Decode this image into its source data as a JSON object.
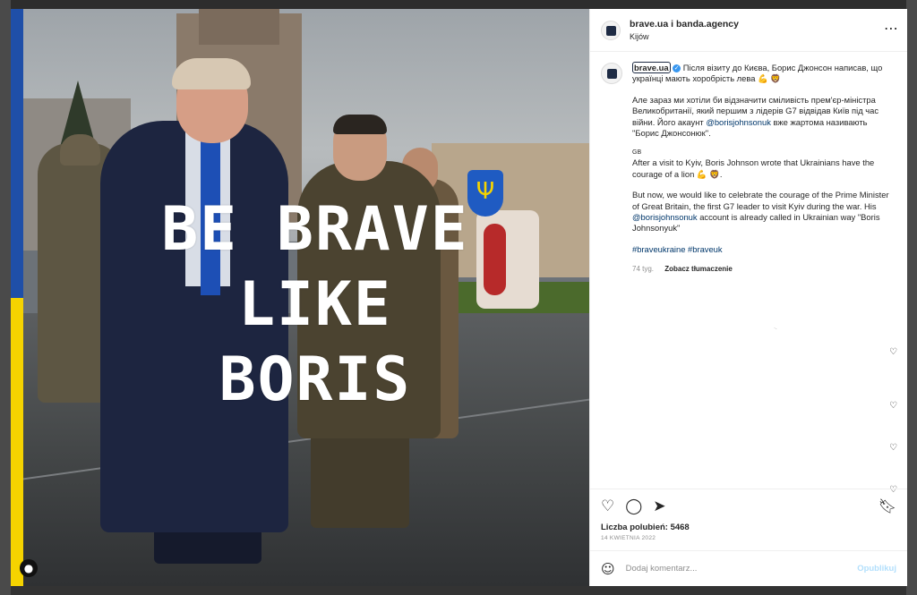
{
  "post": {
    "header": {
      "title": "brave.ua i banda.agency",
      "location": "Kijów",
      "more_icon": "more-horizontal-icon"
    },
    "image": {
      "slogan": [
        "BE BRAVE",
        "LIKE",
        "BORIS"
      ],
      "tag_icon": "user-tag-icon"
    },
    "caption": {
      "username": "brave.ua",
      "verified_icon": "verified-badge-icon",
      "ua_text": "Після візиту до Києва, Борис Джонсон написав, що українці мають хоробрість лева 💪 🦁",
      "ua_para2_a": "Але зараз ми хотіли би відзначити сміливість прем'єр-міністра Великобританії, який першим з лідерів G7 відвідав Київ під час війни. Його акаунт ",
      "ua_para2_link": "@borisjohnsonuk",
      "ua_para2_b": " вже жартома називають \"Борис Джонсонюк\".",
      "gb_label": "GB",
      "en_para1": "After a visit to Kyiv, Boris Johnson wrote that Ukrainians have the courage of a lion 💪 🦁.",
      "en_para2_a": "But now, we would like to celebrate the courage of the Prime Minister of Great Britain, the first G7 leader to visit Kyiv during the war. His ",
      "en_para2_link": "@borisjohnsonuk",
      "en_para2_b": " account is already called in Ukrainian way \"Boris Johnsonyuk\"",
      "hashtags": "#braveukraine #braveuk",
      "age": "74 tyg.",
      "translate": "Zobacz tłumaczenie"
    },
    "actions": {
      "like_icon": "heart-icon",
      "comment_icon": "comment-icon",
      "share_icon": "send-icon",
      "save_icon": "bookmark-icon"
    },
    "likes": "Liczba polubień: 5468",
    "date": "14 KWIETNIA 2022",
    "comment_box": {
      "placeholder": "Dodaj komentarz...",
      "publish": "Opublikuj",
      "emoji_icon": "emoji-icon"
    }
  },
  "colors": {
    "flag_blue": "#1f4fa8",
    "flag_yellow": "#f5d300",
    "link": "#00376b",
    "publish_disabled": "#b2dffc"
  }
}
